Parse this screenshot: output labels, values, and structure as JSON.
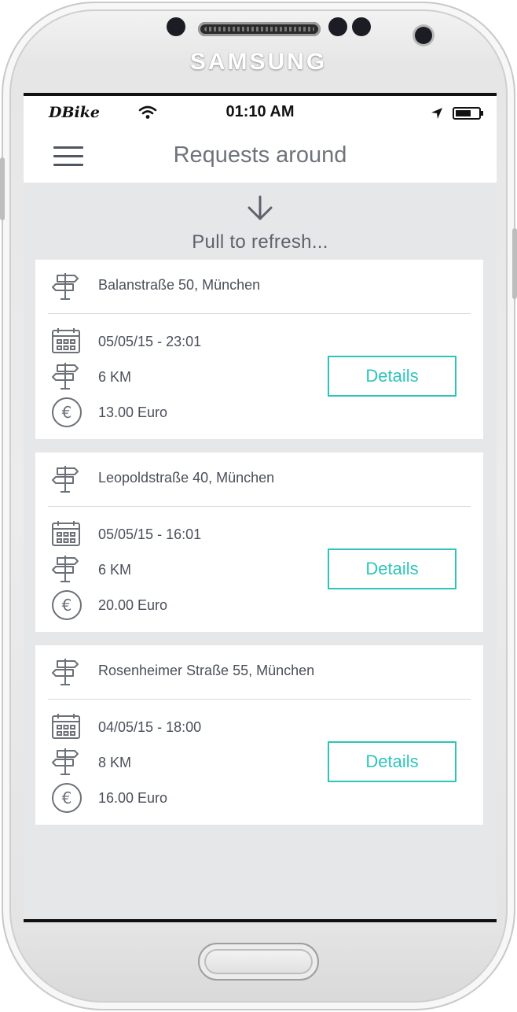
{
  "device": {
    "brand": "SAMSUNG"
  },
  "status_bar": {
    "carrier": "DBike",
    "time": "01:10 AM",
    "icons": [
      "wifi-icon",
      "location-arrow-icon",
      "battery-icon"
    ]
  },
  "navbar": {
    "menu_icon": "hamburger-menu-icon",
    "title": "Requests around"
  },
  "pull_to_refresh": {
    "icon": "arrow-down-icon",
    "text": "Pull to refresh..."
  },
  "requests": [
    {
      "address": "Balanstraße 50, München",
      "datetime": "05/05/15 - 23:01",
      "distance": "6 KM",
      "price": "13.00 Euro",
      "button": "Details"
    },
    {
      "address": "Leopoldstraße 40, München",
      "datetime": "05/05/15 - 16:01",
      "distance": "6 KM",
      "price": "20.00 Euro",
      "button": "Details"
    },
    {
      "address": "Rosenheimer Straße 55, München",
      "datetime": "04/05/15 - 18:00",
      "distance": "8 KM",
      "price": "16.00 Euro",
      "button": "Details"
    }
  ],
  "colors": {
    "accent": "#2cc4bb",
    "screen_background": "#e6e7e9",
    "text_primary": "#4a4f5a",
    "title_text": "#6f737c"
  }
}
